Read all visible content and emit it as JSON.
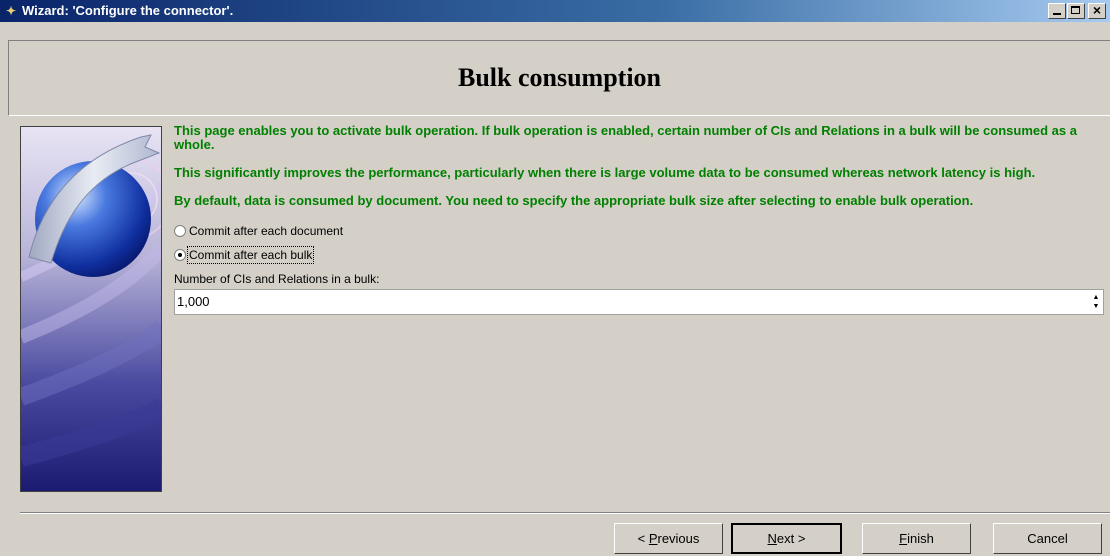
{
  "window": {
    "title": "Wizard: 'Configure the connector'.",
    "icon": "wand-icon",
    "controls": [
      "minimize",
      "maximize",
      "close"
    ]
  },
  "header": {
    "title": "Bulk consumption"
  },
  "description": {
    "paragraph1": "This page enables you to activate bulk operation. If bulk operation is enabled, certain number of CIs and Relations in a bulk will be consumed as a whole.",
    "paragraph2": "This significantly improves the performance, particularly when there is large volume data to be consumed whereas network latency is high.",
    "paragraph3": "By default, data is consumed by document. You need to specify the appropriate bulk size after selecting to enable bulk operation."
  },
  "options": {
    "commit_each_document": {
      "label": "Commit after each document",
      "checked": false
    },
    "commit_each_bulk": {
      "label": "Commit after each bulk",
      "checked": true
    }
  },
  "bulk_size": {
    "label": "Number of CIs and Relations in a bulk:",
    "value": "1,000"
  },
  "buttons": {
    "previous": {
      "label_pre": "< ",
      "label_mnemonic": "P",
      "label_rest": "revious"
    },
    "next": {
      "label_mnemonic": "N",
      "label_rest": "ext >"
    },
    "finish": {
      "label_mnemonic": "F",
      "label_rest": "inish"
    },
    "cancel": {
      "label": "Cancel"
    }
  },
  "colors": {
    "text_accent": "#008000",
    "title_bar": "#0a246a",
    "dialog_bg": "#d4d0c8"
  }
}
